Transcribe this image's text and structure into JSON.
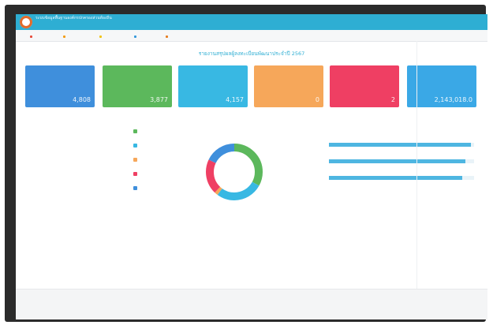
{
  "header": {
    "brand_line1": "ระบบข้อมูลพื้นฐานองค์กรปกครองส่วนท้องถิ่น",
    "brand_line2": "",
    "top_right": ""
  },
  "nav": {
    "items": [
      {
        "label": "",
        "color": "#e74c3c"
      },
      {
        "label": "",
        "color": "#f39c12"
      },
      {
        "label": "",
        "color": "#f1c40f"
      },
      {
        "label": "",
        "color": "#3498db"
      },
      {
        "label": "",
        "color": "#e67e22"
      }
    ],
    "right_label": ""
  },
  "page": {
    "title": "รายงานสรุปผลผู้ลงทะเบียนพัฒนาประจำปี 2567"
  },
  "stats": [
    {
      "label": "",
      "value": "4,808",
      "color": "#3f8fdc"
    },
    {
      "label": "",
      "value": "3,877",
      "color": "#5cb85c"
    },
    {
      "label": "",
      "value": "4,157",
      "color": "#38b8e3"
    },
    {
      "label": "",
      "value": "0",
      "color": "#f6a75a"
    },
    {
      "label": "",
      "value": "2",
      "color": "#ef3f63"
    },
    {
      "label": "",
      "value": "2,143,018.0",
      "color": "#3aa8e6"
    }
  ],
  "left_panel": {
    "title": "",
    "legend": [
      {
        "label": "",
        "color": "#5cb85c",
        "value": ""
      },
      {
        "label": "",
        "color": "#38b8e3",
        "value": ""
      },
      {
        "label": "",
        "color": "#f6a75a",
        "value": ""
      },
      {
        "label": "",
        "color": "#ef3f63",
        "value": ""
      },
      {
        "label": "",
        "color": "#3f8fdc",
        "value": ""
      }
    ]
  },
  "middle_panel": {
    "title": "",
    "callout_right": "",
    "callout_bottom": ""
  },
  "donut": [
    {
      "color": "#5cb85c",
      "fraction": 0.33
    },
    {
      "color": "#38b8e3",
      "fraction": 0.27
    },
    {
      "color": "#f6a75a",
      "fraction": 0.02
    },
    {
      "color": "#ef3f63",
      "fraction": 0.2
    },
    {
      "color": "#3f8fdc",
      "fraction": 0.18
    }
  ],
  "right_panel": {
    "title": "",
    "bars": [
      {
        "label": "",
        "value_text": "",
        "fraction": 0.98
      },
      {
        "label": "",
        "value_text": "",
        "fraction": 0.94
      },
      {
        "label": "",
        "value_text": "",
        "fraction": 0.92
      }
    ]
  }
}
